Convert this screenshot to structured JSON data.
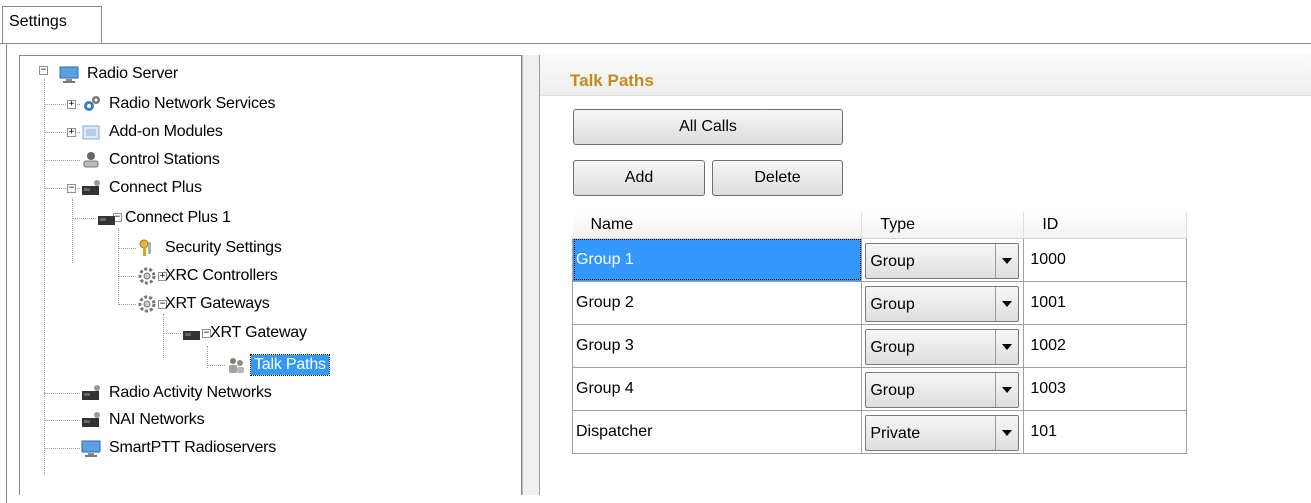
{
  "tabs": [
    {
      "label": "Settings"
    }
  ],
  "tree": {
    "items": [
      {
        "label": "Radio Server",
        "icon": "monitor-icon"
      },
      {
        "label": "Radio Network Services",
        "icon": "gear-network-icon"
      },
      {
        "label": "Add-on Modules",
        "icon": "modules-icon"
      },
      {
        "label": "Control Stations",
        "icon": "control-station-icon"
      },
      {
        "label": "Connect Plus",
        "icon": "repeater-icon"
      },
      {
        "label": "Connect Plus 1",
        "icon": "repeater-icon"
      },
      {
        "label": "Security Settings",
        "icon": "keys-icon"
      },
      {
        "label": "XRC Controllers",
        "icon": "cog-icon"
      },
      {
        "label": "XRT Gateways",
        "icon": "cog-icon"
      },
      {
        "label": "XRT Gateway",
        "icon": "repeater-icon"
      },
      {
        "label": "Talk Paths",
        "icon": "talk-paths-icon"
      },
      {
        "label": "Radio Activity Networks",
        "icon": "repeater-icon"
      },
      {
        "label": "NAI Networks",
        "icon": "repeater-icon"
      },
      {
        "label": "SmartPTT Radioservers",
        "icon": "monitor-icon"
      }
    ],
    "selected": "Talk Paths"
  },
  "main": {
    "title": "Talk Paths",
    "all_calls_label": "All Calls",
    "add_label": "Add",
    "delete_label": "Delete",
    "columns": [
      "Name",
      "Type",
      "ID"
    ],
    "rows": [
      {
        "name": "Group 1",
        "type": "Group",
        "id": "1000"
      },
      {
        "name": "Group 2",
        "type": "Group",
        "id": "1001"
      },
      {
        "name": "Group 3",
        "type": "Group",
        "id": "1002"
      },
      {
        "name": "Group 4",
        "type": "Group",
        "id": "1003"
      },
      {
        "name": "Dispatcher",
        "type": "Private",
        "id": "101"
      }
    ]
  },
  "colors": {
    "title": "#c58a1e",
    "selection": "#3399ff"
  }
}
